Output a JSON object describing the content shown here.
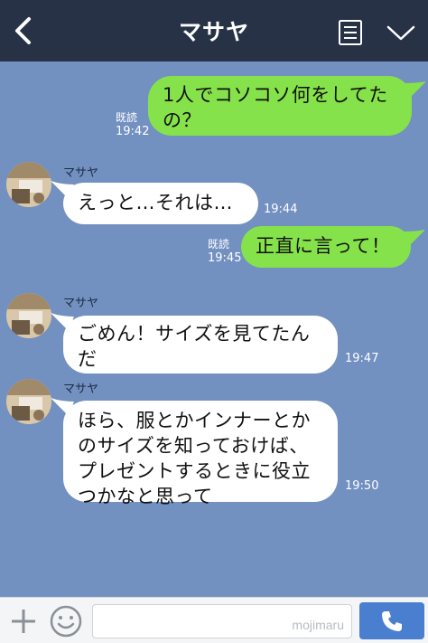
{
  "header": {
    "title": "マサヤ",
    "icons": {
      "back": "chevron-left-icon",
      "notes": "notes-list-icon",
      "menu": "chevron-down-icon"
    }
  },
  "messages": [
    {
      "side": "right",
      "text": "1人でコソコソ何をしてたの？",
      "read": "既読",
      "time": "19:42"
    },
    {
      "side": "left",
      "sender": "マサヤ",
      "text": "えっと…それは…",
      "time": "19:44"
    },
    {
      "side": "right",
      "text": "正直に言って！",
      "read": "既読",
      "time": "19:45"
    },
    {
      "side": "left",
      "sender": "マサヤ",
      "text": "ごめん！サイズを見てたんだ",
      "time": "19:47"
    },
    {
      "side": "left",
      "sender": "マサヤ",
      "text": "ほら、服とかインナーとかのサイズを知っておけば、プレゼントするときに役立つかなと思って",
      "time": "19:50"
    }
  ],
  "bottom_bar": {
    "watermark": "mojimaru",
    "icons": {
      "add": "plus-icon",
      "emoji": "smiley-icon",
      "call": "phone-icon"
    }
  },
  "colors": {
    "header_bg": "#273246",
    "chat_bg": "#7290c0",
    "outgoing_bubble": "#86e24a",
    "incoming_bubble": "#ffffff",
    "call_button": "#4a7fcf"
  }
}
